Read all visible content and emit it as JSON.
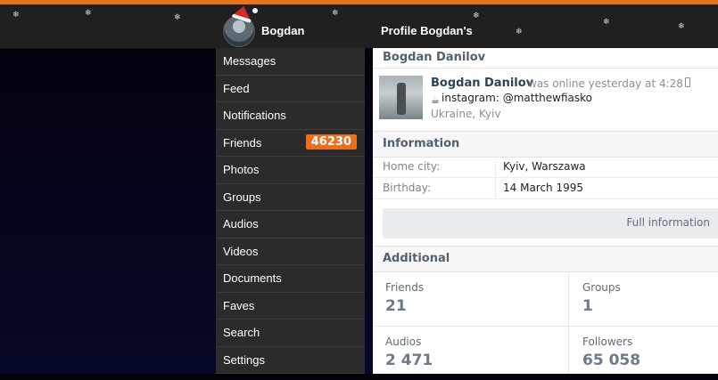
{
  "header": {
    "user_name": "Bogdan",
    "page_title": "Profile Bogdan's"
  },
  "sidebar": {
    "items": [
      {
        "label": "Messages"
      },
      {
        "label": "Feed"
      },
      {
        "label": "Notifications"
      },
      {
        "label": "Friends",
        "badge": "46230"
      },
      {
        "label": "Photos"
      },
      {
        "label": "Groups"
      },
      {
        "label": "Audios"
      },
      {
        "label": "Videos"
      },
      {
        "label": "Documents"
      },
      {
        "label": "Faves"
      },
      {
        "label": "Search"
      },
      {
        "label": "Settings"
      }
    ]
  },
  "profile": {
    "title": "Bogdan Danilov",
    "name": "Bogdan Danilov",
    "status": "was online yesterday at 4:28",
    "bio": "instagram: @matthewfiasko",
    "location": "Ukraine, Kyiv"
  },
  "information": {
    "title": "Information",
    "rows": [
      {
        "label": "Home city:",
        "value": "Kyiv, Warszawa"
      },
      {
        "label": "Birthday:",
        "value": "14 March 1995"
      }
    ],
    "full_info_label": "Full information"
  },
  "additional": {
    "title": "Additional",
    "counters": [
      {
        "label": "Friends",
        "value": "21"
      },
      {
        "label": "Groups",
        "value": "1"
      },
      {
        "label": "Audios",
        "value": "2 471"
      },
      {
        "label": "Followers",
        "value": "65 058"
      }
    ]
  },
  "colors": {
    "accent": "#e8741c",
    "badge": "#ec6f1e",
    "header_bg": "#202020",
    "sidebar_bg": "#2b2b2b",
    "link_text": "#2f4358"
  },
  "icons": {
    "snowflake": "❄",
    "phone": "phone-icon",
    "coffee": "☕"
  }
}
